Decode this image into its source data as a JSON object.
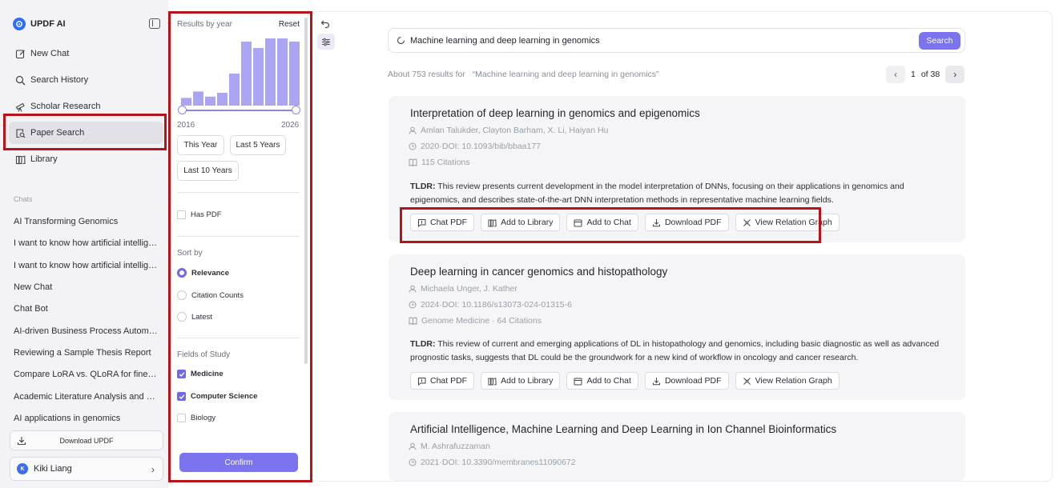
{
  "app": {
    "name": "UPDF AI"
  },
  "sidebar": {
    "nav": [
      {
        "label": "New Chat",
        "icon": "edit-icon"
      },
      {
        "label": "Search History",
        "icon": "search-icon"
      },
      {
        "label": "Scholar Research",
        "icon": "telescope-icon"
      },
      {
        "label": "Paper Search",
        "icon": "paper-search-icon",
        "active": true
      },
      {
        "label": "Library",
        "icon": "library-icon"
      }
    ],
    "chats_label": "Chats",
    "chats": [
      "AI Transforming Genomics",
      "I want to know how artificial intelligence",
      "I want to know how artificial intelligence",
      "New Chat",
      "Chat Bot",
      "AI-driven Business Process Automation",
      "Reviewing a Sample Thesis Report",
      "Compare LoRA vs. QLoRA for fine-tuning",
      "Academic Literature Analysis and Strategy",
      "AI applications in genomics"
    ],
    "download_label": "Download UPDF",
    "user": {
      "name": "Kiki Liang",
      "initial": "K"
    }
  },
  "filter": {
    "title": "Results by year",
    "reset": "Reset",
    "histogram": [
      0.12,
      0.22,
      0.14,
      0.2,
      0.5,
      1.0,
      0.9,
      1.05,
      1.05,
      1.0
    ],
    "year_start": "2016",
    "year_end": "2026",
    "chips": [
      "This Year",
      "Last 5 Years",
      "Last 10 Years"
    ],
    "has_pdf": "Has PDF",
    "sort_label": "Sort by",
    "sort_options": [
      {
        "label": "Relevance",
        "selected": true
      },
      {
        "label": "Citation Counts",
        "selected": false
      },
      {
        "label": "Latest",
        "selected": false
      }
    ],
    "fields_label": "Fields of Study",
    "fields": [
      {
        "label": "Medicine",
        "checked": true
      },
      {
        "label": "Computer Science",
        "checked": true
      },
      {
        "label": "Biology",
        "checked": false
      }
    ],
    "confirm": "Confirm"
  },
  "search": {
    "query": "Machine learning and deep learning in genomics",
    "button": "Search",
    "summary_prefix": "About 753 results for",
    "summary_query": "“Machine learning and deep learning in genomics”"
  },
  "pager": {
    "current": "1",
    "total": "of 38"
  },
  "actions": [
    "Chat PDF",
    "Add to Library",
    "Add to Chat",
    "Download PDF",
    "View Relation Graph"
  ],
  "results": [
    {
      "title": "Interpretation of deep learning in genomics and epigenomics",
      "authors": "Amlan Talukder, Clayton Barham, X. Li, Haiyan Hu",
      "doi": "2020·DOI: 10.1093/bib/bbaa177",
      "citations": "115 Citations",
      "tldr_label": "TLDR:",
      "tldr": "This review presents current development in the model interpretation of DNNs, focusing on their applications in genomics and epigenomics, and describes state-of-the-art DNN interpretation methods in representative machine learning fields."
    },
    {
      "title": "Deep learning in cancer genomics and histopathology",
      "authors": "Michaela Unger, J. Kather",
      "doi": "2024·DOI: 10.1186/s13073-024-01315-6",
      "citations": "Genome Medicine · 64 Citations",
      "tldr_label": "TLDR:",
      "tldr": "This review of current and emerging applications of DL in histopathology and genomics, including basic diagnostic as well as advanced prognostic tasks, suggests that DL could be the groundwork for a new kind of workflow in oncology and cancer research."
    },
    {
      "title": "Artificial Intelligence, Machine Learning and Deep Learning in Ion Channel Bioinformatics",
      "authors": "M. Ashrafuzzaman",
      "doi": "2021·DOI: 10.3390/membranes11090672"
    }
  ],
  "colors": {
    "accent": "#7b74ee",
    "highlight": "#b9131a"
  }
}
